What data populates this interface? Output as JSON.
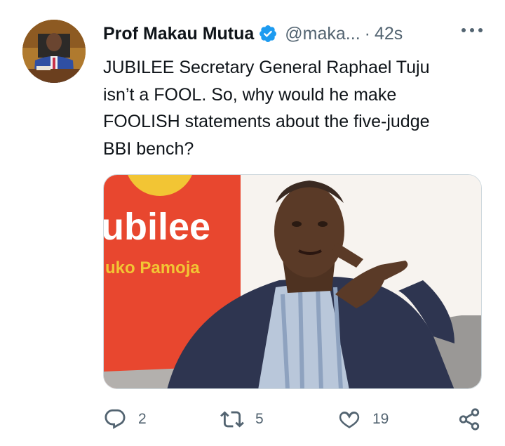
{
  "tweet": {
    "author_name": "Prof Makau Mutua",
    "handle": "@maka...",
    "separator": "·",
    "time": "42s",
    "text": "JUBILEE Secretary General Raphael Tuju\nisn’t a FOOL.  So, why would he make\nFOOLISH statements about the five-judge\nBBI bench?",
    "media": {
      "sign_text_main": "ubilee",
      "sign_text_sub": "uko Pamoja",
      "accent_color": "#e8472f"
    }
  },
  "actions": {
    "reply_count": "2",
    "retweet_count": "5",
    "like_count": "19"
  },
  "colors": {
    "verified_badge": "#1d9bf0",
    "secondary_text": "#536471",
    "border": "#cfd9de"
  }
}
